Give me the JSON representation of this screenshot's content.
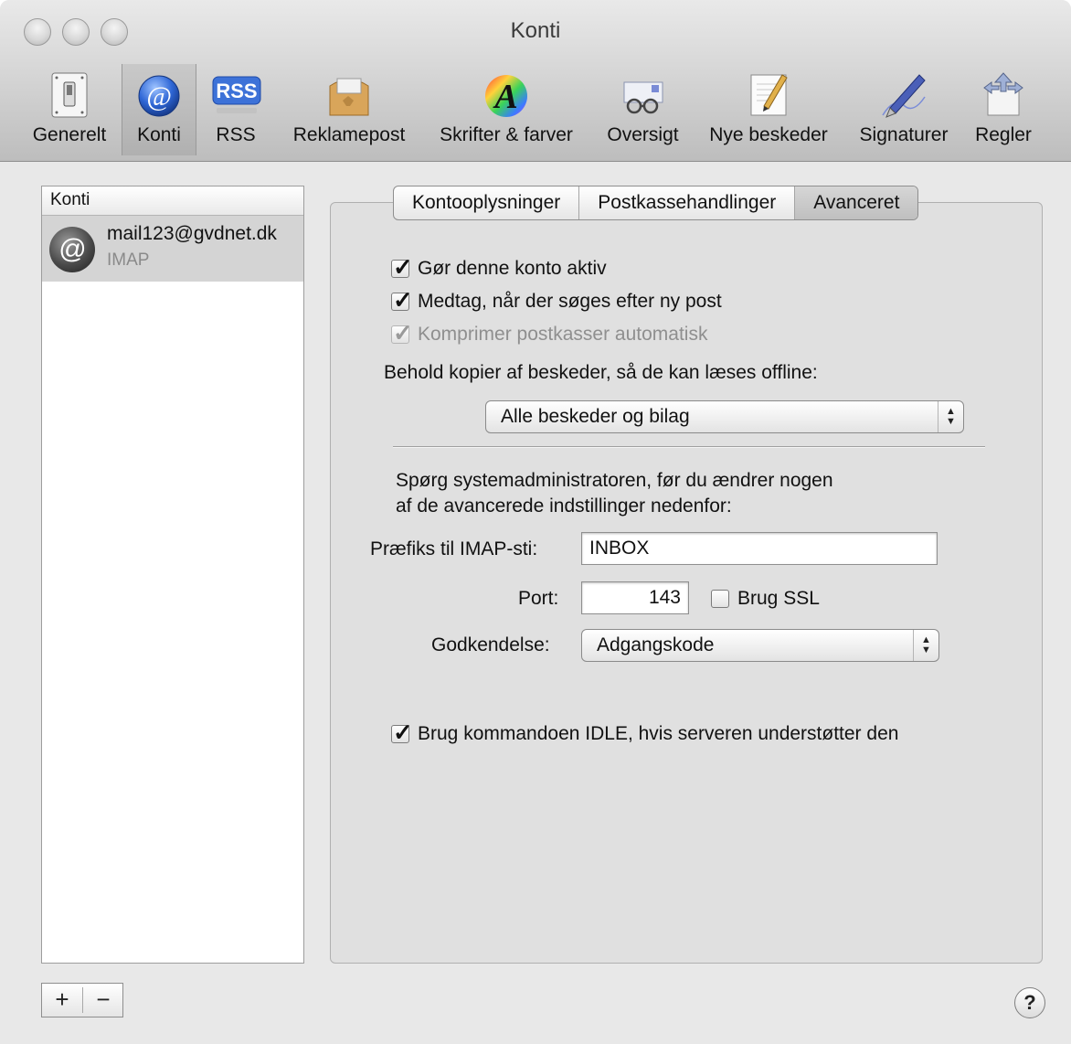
{
  "window": {
    "title": "Konti"
  },
  "toolbar": {
    "items": [
      {
        "label": "Generelt",
        "icon": "switch-icon"
      },
      {
        "label": "Konti",
        "icon": "at-sign-icon"
      },
      {
        "label": "RSS",
        "icon": "rss-icon"
      },
      {
        "label": "Reklamepost",
        "icon": "junk-mail-bag-icon"
      },
      {
        "label": "Skrifter & farver",
        "icon": "font-color-icon"
      },
      {
        "label": "Oversigt",
        "icon": "glasses-icon"
      },
      {
        "label": "Nye beskeder",
        "icon": "pencil-paper-icon"
      },
      {
        "label": "Signaturer",
        "icon": "fountain-pen-icon"
      },
      {
        "label": "Regler",
        "icon": "rules-arrows-icon"
      }
    ],
    "selected": "Konti",
    "rss_badge": "RSS"
  },
  "accounts": {
    "header": "Konti",
    "items": [
      {
        "email": "mail123@gvdnet.dk",
        "type": "IMAP"
      }
    ],
    "add_label": "+",
    "remove_label": "−"
  },
  "tabs": {
    "items": [
      "Kontooplysninger",
      "Postkassehandlinger",
      "Avanceret"
    ],
    "selected": "Avanceret"
  },
  "advanced": {
    "enable_account": {
      "label": "Gør denne konto aktiv",
      "checked": true
    },
    "include_check": {
      "label": "Medtag, når der søges efter ny post",
      "checked": true
    },
    "compact": {
      "label": "Komprimer postkasser automatisk",
      "checked": true,
      "disabled": true
    },
    "keep_copies_label": "Behold kopier af beskeder, så de kan læses offline:",
    "keep_copies_value": "Alle beskeder og bilag",
    "admin_note_line1": "Spørg systemadministratoren, før du ændrer nogen",
    "admin_note_line2": "af de avancerede indstillinger nedenfor:",
    "imap_prefix_label": "Præfiks til IMAP-sti:",
    "imap_prefix_value": "INBOX",
    "port_label": "Port:",
    "port_value": "143",
    "ssl": {
      "label": "Brug SSL",
      "checked": false
    },
    "auth_label": "Godkendelse:",
    "auth_value": "Adgangskode",
    "idle": {
      "label": "Brug kommandoen IDLE, hvis serveren understøtter den",
      "checked": true
    }
  },
  "help_label": "?",
  "checkmark": "✓",
  "popup_arrows": "▲▼"
}
